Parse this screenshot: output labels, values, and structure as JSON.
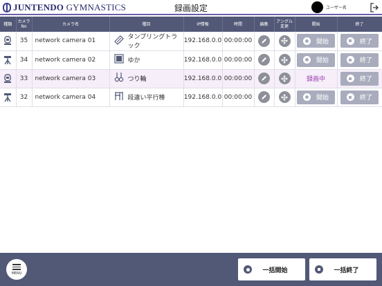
{
  "header": {
    "logo_main": "JUNTENDO",
    "logo_sub": "GYMNASTICS",
    "title": "録画設定",
    "user_name": "ユーザー名"
  },
  "table": {
    "columns": {
      "type": "種類",
      "camera_no_1": "カメラ",
      "camera_no_2": "No",
      "camera_name": "カメラ名",
      "event": "種目",
      "ip": "IP情報",
      "time": "時間",
      "edit": "編集",
      "angle_1": "アングル",
      "angle_2": "変更",
      "start": "開始",
      "stop": "終了"
    },
    "rows": [
      {
        "type_icon": "camera-robot-icon",
        "no": "35",
        "name": "network camera 01",
        "event_icon": "tumbling-track-icon",
        "event": "タンブリングトラック",
        "ip": "192.168.0.0",
        "time": "00:00:00",
        "start": "開始",
        "stop": "終了",
        "recording": false
      },
      {
        "type_icon": "tripod-camera-icon",
        "no": "34",
        "name": "network camera 02",
        "event_icon": "floor-icon",
        "event": "ゆか",
        "ip": "192.168.0.0",
        "time": "00:00:00",
        "start": "開始",
        "stop": "終了",
        "recording": false
      },
      {
        "type_icon": "camera-robot-icon",
        "no": "33",
        "name": "network camera 03",
        "event_icon": "rings-icon",
        "event": "つり輪",
        "ip": "192.168.0.0",
        "time": "00:00:00",
        "start": "録画中",
        "stop": "終了",
        "recording": true
      },
      {
        "type_icon": "tripod-camera-icon",
        "no": "32",
        "name": "network camera 04",
        "event_icon": "uneven-bars-icon",
        "event": "段違い平行棒",
        "ip": "192.168.0.0",
        "time": "00:00:00",
        "start": "開始",
        "stop": "終了",
        "recording": false
      }
    ]
  },
  "footer": {
    "menu_label": "MENU",
    "bulk_start": "一括開始",
    "bulk_stop": "一括終了"
  },
  "colors": {
    "header_bg": "#525977",
    "accent": "#6a5fa8",
    "recording_text": "#9b3fb0",
    "recording_row": "#f6eef9",
    "button_gray": "#a9acbd"
  }
}
